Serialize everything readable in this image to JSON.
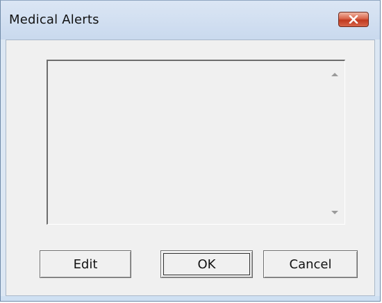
{
  "window": {
    "title": "Medical Alerts"
  },
  "titlebar": {
    "close_icon": "close-icon"
  },
  "alerts_list": {
    "items": []
  },
  "buttons": {
    "edit_label": "Edit",
    "ok_label": "OK",
    "cancel_label": "Cancel"
  },
  "colors": {
    "title_bar": "#c9d9ee",
    "close_button": "#c0391f",
    "client_background": "#f0f0f0"
  }
}
